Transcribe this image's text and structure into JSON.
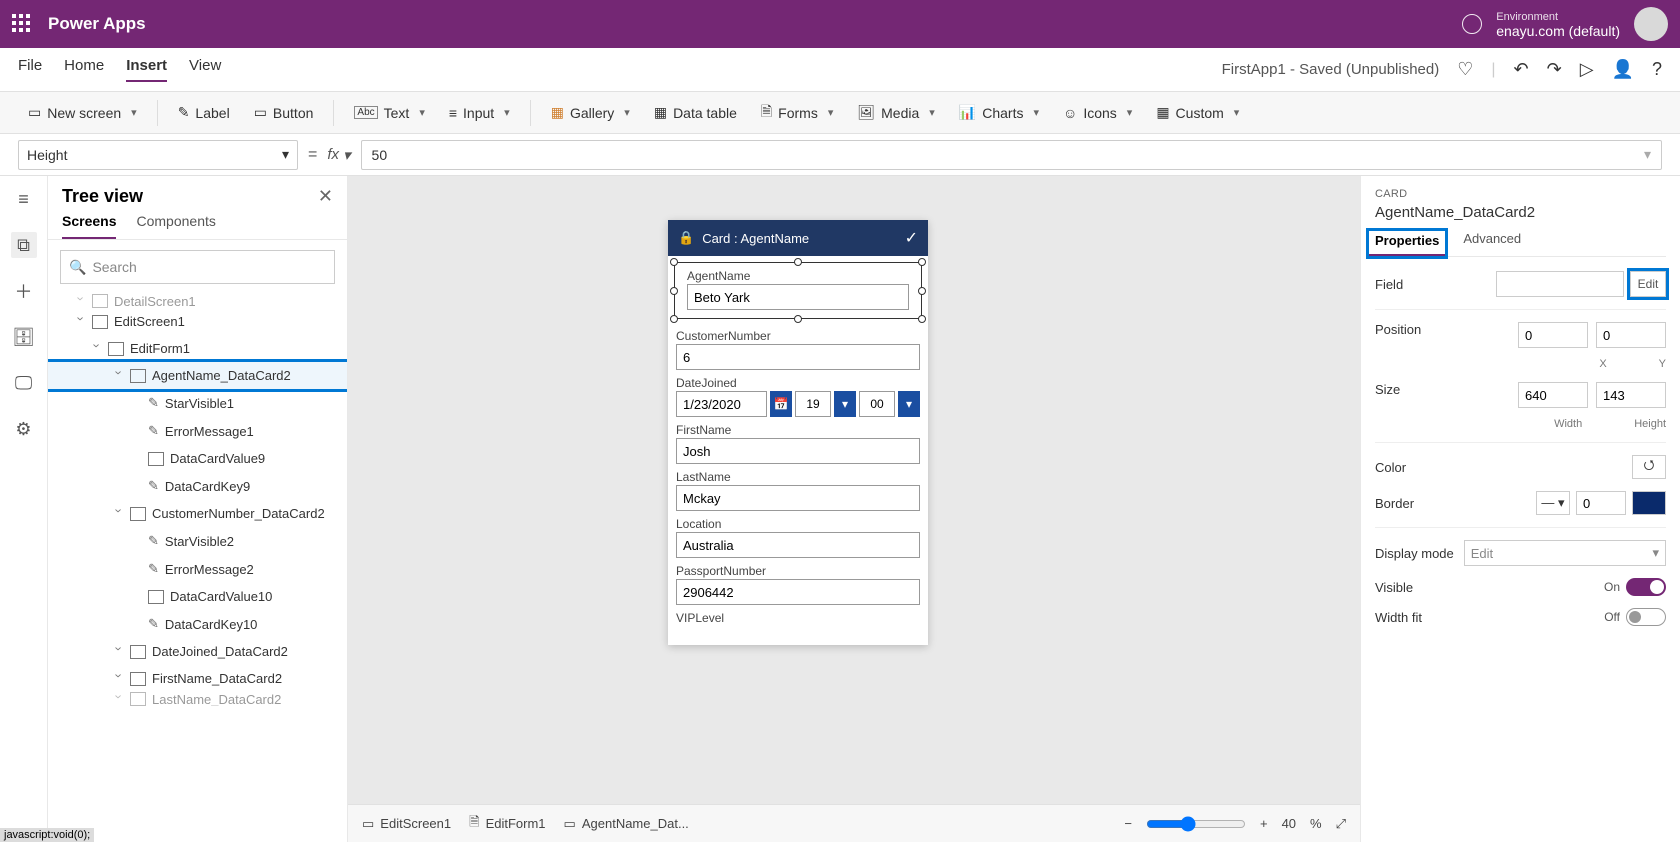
{
  "top": {
    "brand": "Power Apps",
    "env_label": "Environment",
    "env_value": "enayu.com (default)"
  },
  "menu": {
    "items": [
      "File",
      "Home",
      "Insert",
      "View"
    ],
    "status": "FirstApp1 - Saved (Unpublished)"
  },
  "ribbon": {
    "newscreen": "New screen",
    "label": "Label",
    "button": "Button",
    "text": "Text",
    "input": "Input",
    "gallery": "Gallery",
    "datatable": "Data table",
    "forms": "Forms",
    "media": "Media",
    "charts": "Charts",
    "icons": "Icons",
    "custom": "Custom"
  },
  "formula": {
    "prop": "Height",
    "value": "50"
  },
  "tree": {
    "title": "Tree view",
    "tabs": [
      "Screens",
      "Components"
    ],
    "search": "Search",
    "items": [
      {
        "indent": 1,
        "label": "DetailScreen1",
        "cls": "cut"
      },
      {
        "indent": 1,
        "label": "EditScreen1"
      },
      {
        "indent": 2,
        "label": "EditForm1"
      },
      {
        "indent": 3,
        "label": "AgentName_DataCard2",
        "hi": true
      },
      {
        "indent": 4,
        "label": "StarVisible1",
        "leaf": true,
        "pen": true
      },
      {
        "indent": 4,
        "label": "ErrorMessage1",
        "leaf": true,
        "pen": true
      },
      {
        "indent": 4,
        "label": "DataCardValue9",
        "leaf": true
      },
      {
        "indent": 4,
        "label": "DataCardKey9",
        "leaf": true,
        "pen": true
      },
      {
        "indent": 3,
        "label": "CustomerNumber_DataCard2"
      },
      {
        "indent": 4,
        "label": "StarVisible2",
        "leaf": true,
        "pen": true
      },
      {
        "indent": 4,
        "label": "ErrorMessage2",
        "leaf": true,
        "pen": true
      },
      {
        "indent": 4,
        "label": "DataCardValue10",
        "leaf": true
      },
      {
        "indent": 4,
        "label": "DataCardKey10",
        "leaf": true,
        "pen": true
      },
      {
        "indent": 3,
        "label": "DateJoined_DataCard2"
      },
      {
        "indent": 3,
        "label": "FirstName_DataCard2"
      },
      {
        "indent": 3,
        "label": "LastName_DataCard2",
        "cls": "cut"
      }
    ]
  },
  "canvas": {
    "cardtitle": "Card : AgentName",
    "fields": [
      {
        "label": "AgentName",
        "value": "Beto Yark",
        "sel": true
      },
      {
        "label": "CustomerNumber",
        "value": "6"
      },
      {
        "label": "DateJoined",
        "value": "1/23/2020",
        "date": true,
        "h": "19",
        "m": "00"
      },
      {
        "label": "FirstName",
        "value": "Josh"
      },
      {
        "label": "LastName",
        "value": "Mckay"
      },
      {
        "label": "Location",
        "value": "Australia"
      },
      {
        "label": "PassportNumber",
        "value": "2906442"
      },
      {
        "label": "VIPLevel",
        "value": "",
        "cut": true
      }
    ],
    "crumbs": [
      "EditScreen1",
      "EditForm1",
      "AgentName_Dat..."
    ],
    "zoom": "40",
    "zoomunit": "%"
  },
  "props": {
    "cat": "CARD",
    "name": "AgentName_DataCard2",
    "tabs": [
      "Properties",
      "Advanced"
    ],
    "field_lbl": "Field",
    "edit": "Edit",
    "pos_lbl": "Position",
    "pos_x": "0",
    "pos_y": "0",
    "pos_xl": "X",
    "pos_yl": "Y",
    "size_lbl": "Size",
    "size_w": "640",
    "size_h": "143",
    "size_wl": "Width",
    "size_hl": "Height",
    "color_lbl": "Color",
    "border_lbl": "Border",
    "border_val": "0",
    "dmode_lbl": "Display mode",
    "dmode_val": "Edit",
    "vis_lbl": "Visible",
    "vis_state": "On",
    "wfit_lbl": "Width fit",
    "wfit_state": "Off"
  },
  "status": "javascript:void(0);"
}
